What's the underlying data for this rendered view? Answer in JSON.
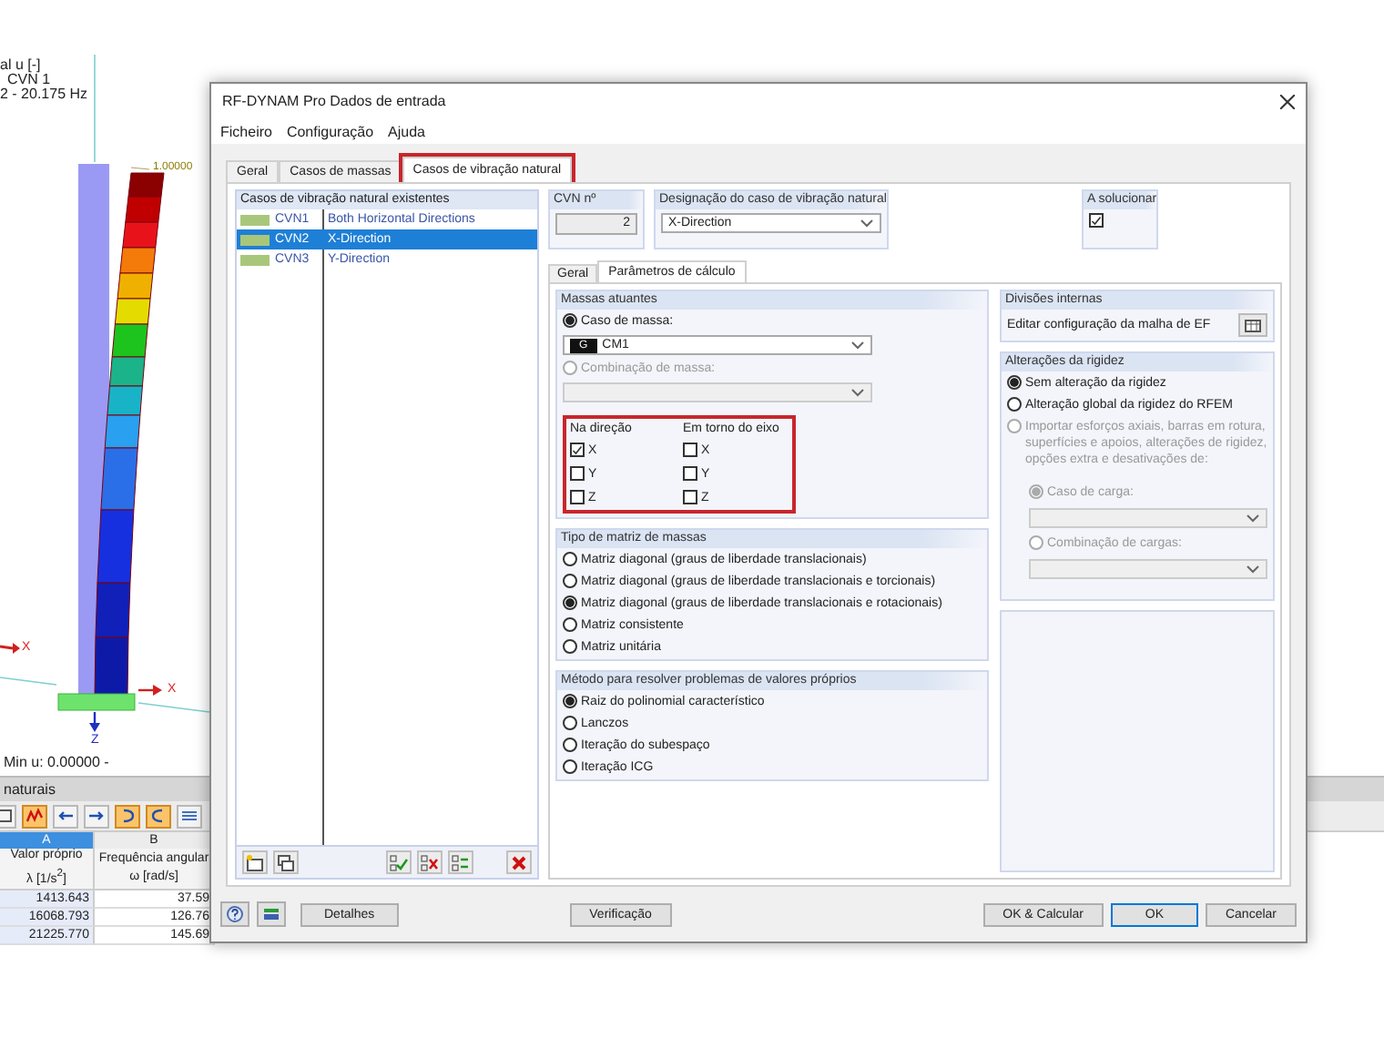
{
  "viewer": {
    "legend": [
      "al u [-]",
      "CVN 1",
      "2 - 20.175 Hz"
    ],
    "max_label": "1.00000",
    "axis_labels": [
      "X",
      "X",
      "Z"
    ],
    "min_label": "Min u: 0.00000 -"
  },
  "results_panel": {
    "title": "naturais",
    "toolbar": [
      {
        "on": false
      },
      {
        "on": true
      },
      {
        "on": false
      },
      {
        "on": false
      },
      {
        "on": true
      },
      {
        "on": true
      },
      {
        "on": false
      }
    ],
    "columns": [
      {
        "letter": "A",
        "title": "Valor próprio",
        "unit": "λ [1/s$^{2}$]",
        "selected": true
      },
      {
        "letter": "B",
        "title": "Frequência angular",
        "unit": "ω [rad/s]",
        "selected": false
      }
    ],
    "rows": [
      [
        "1413.643",
        "37.59"
      ],
      [
        "16068.793",
        "126.76"
      ],
      [
        "21225.770",
        "145.69"
      ]
    ]
  },
  "dialog": {
    "title": "RF-DYNAM Pro Dados de entrada",
    "menu": [
      "Ficheiro",
      "Configuração",
      "Ajuda"
    ],
    "tabs": [
      {
        "label": "Geral",
        "selected": false,
        "highlighted": false
      },
      {
        "label": "Casos de massas",
        "selected": false,
        "highlighted": false
      },
      {
        "label": "Casos de vibração natural",
        "selected": true,
        "highlighted": true
      }
    ],
    "case_list": {
      "header": "Casos de vibração natural existentes",
      "rows": [
        {
          "color": "#a9c77a",
          "id": "CVN1",
          "name": "Both Horizontal Directions",
          "selected": false
        },
        {
          "color": "#a9c77a",
          "id": "CVN2",
          "name": "X-Direction",
          "selected": true
        },
        {
          "color": "#a9c77a",
          "id": "CVN3",
          "name": "Y-Direction",
          "selected": false
        }
      ]
    },
    "cvn_no": {
      "label": "CVN nº",
      "value": "2"
    },
    "designation": {
      "label": "Designação do caso de vibração natural",
      "value": "X-Direction"
    },
    "solve": {
      "label": "A solucionar",
      "checked": true
    },
    "subtabs": [
      {
        "label": "Geral",
        "selected": false
      },
      {
        "label": "Parâmetros de cálculo",
        "selected": true
      }
    ],
    "masses": {
      "title": "Massas atuantes",
      "options": [
        {
          "label": "Caso de massa:",
          "selected": true,
          "disabled": false,
          "tag": "G",
          "value": "CM1"
        },
        {
          "label": "Combinação de massa:",
          "selected": false,
          "disabled": true
        }
      ],
      "highlighted": true,
      "direction": {
        "title": "Na direção",
        "items": [
          {
            "label": "X",
            "checked": true
          },
          {
            "label": "Y",
            "checked": false
          },
          {
            "label": "Z",
            "checked": false
          }
        ]
      },
      "rotation": {
        "title": "Em torno do eixo",
        "items": [
          {
            "label": "X",
            "checked": false
          },
          {
            "label": "Y",
            "checked": false
          },
          {
            "label": "Z",
            "checked": false
          }
        ]
      }
    },
    "mass_matrix": {
      "title": "Tipo de matriz de massas",
      "options": [
        {
          "label": "Matriz diagonal (graus de liberdade translacionais)",
          "selected": false
        },
        {
          "label": "Matriz diagonal (graus de liberdade translacionais e torcionais)",
          "selected": false
        },
        {
          "label": "Matriz diagonal (graus de liberdade translacionais e rotacionais)",
          "selected": true
        },
        {
          "label": "Matriz consistente",
          "selected": false
        },
        {
          "label": "Matriz unitária",
          "selected": false
        }
      ]
    },
    "eigen_method": {
      "title": "Método para resolver problemas de valores próprios",
      "options": [
        {
          "label": "Raiz do polinomial característico",
          "selected": true
        },
        {
          "label": "Lanczos",
          "selected": false
        },
        {
          "label": "Iteração do subespaço",
          "selected": false
        },
        {
          "label": "Iteração ICG",
          "selected": false
        }
      ]
    },
    "internal_divisions": {
      "title": "Divisões internas",
      "text": "Editar configuração da malha de EF"
    },
    "stiffness": {
      "title": "Alterações da rigidez",
      "options": [
        {
          "label": "Sem alteração da rigidez",
          "selected": true,
          "disabled": false
        },
        {
          "label": "Alteração global da rigidez do RFEM",
          "selected": false,
          "disabled": false
        },
        {
          "label": "Importar esforços axiais, barras em rotura, superfícies e apoios, alterações de rigidez, opções extra e desativações de:",
          "selected": false,
          "disabled": true
        }
      ],
      "sub_options": [
        {
          "label": "Caso de carga:",
          "selected": true,
          "disabled": true
        },
        {
          "label": "Combinação de cargas:",
          "selected": false,
          "disabled": true
        }
      ]
    },
    "footer_left": [
      {
        "label": "Detalhes",
        "default": false
      }
    ],
    "check_button": {
      "label": "Verificação",
      "default": false
    },
    "footer_right": [
      {
        "label": "OK & Calcular",
        "default": false
      },
      {
        "label": "OK",
        "default": true
      },
      {
        "label": "Cancelar",
        "default": false
      }
    ]
  }
}
